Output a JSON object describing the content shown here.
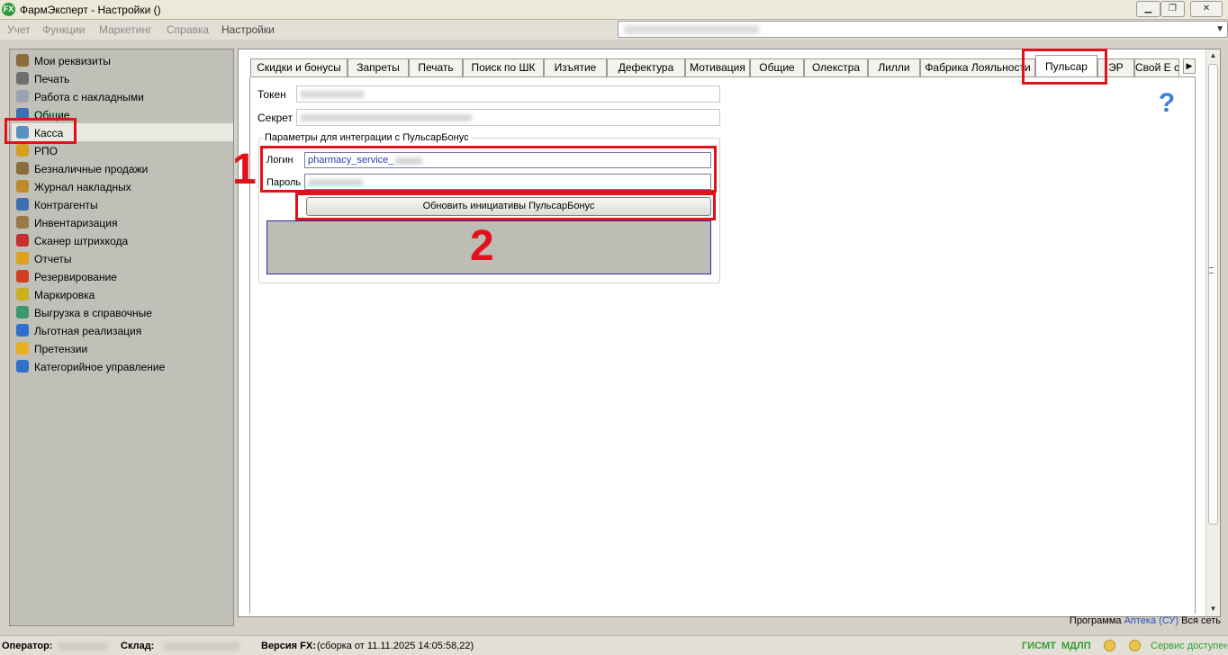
{
  "window": {
    "title": "ФармЭксперт - Настройки ()",
    "app_icon": "FX",
    "minimize": "▁",
    "maximize": "❐",
    "close": "✕"
  },
  "menu": {
    "items": [
      "Учет",
      "Функции",
      "Маркетинг",
      "Справка",
      "Настройки"
    ]
  },
  "sidebar": {
    "items": [
      {
        "label": "Мои реквизиты",
        "icon": "person-icon",
        "color": "#8a6d3b"
      },
      {
        "label": "Печать",
        "icon": "printer-icon",
        "color": "#6f6f6f"
      },
      {
        "label": "Работа с накладными",
        "icon": "document-icon",
        "color": "#9aa4b0"
      },
      {
        "label": "Общие",
        "icon": "folder-icon",
        "color": "#3f6fb0"
      },
      {
        "label": "Касса",
        "icon": "cash-register-icon",
        "color": "#5d8fc4"
      },
      {
        "label": "РПО",
        "icon": "medal-icon",
        "color": "#d6a020"
      },
      {
        "label": "Безналичные продажи",
        "icon": "card-icon",
        "color": "#8a6d3b"
      },
      {
        "label": "Журнал накладных",
        "icon": "journal-icon",
        "color": "#c08a2a"
      },
      {
        "label": "Контрагенты",
        "icon": "contacts-icon",
        "color": "#3f6fb0"
      },
      {
        "label": "Инвентаризация",
        "icon": "inventory-icon",
        "color": "#9a7a4a"
      },
      {
        "label": "Сканер штрихкода",
        "icon": "barcode-icon",
        "color": "#c43030"
      },
      {
        "label": "Отчеты",
        "icon": "chart-icon",
        "color": "#e0a020"
      },
      {
        "label": "Резервирование",
        "icon": "reserve-icon",
        "color": "#d04020"
      },
      {
        "label": "Маркировка",
        "icon": "check-icon",
        "color": "#c8b020"
      },
      {
        "label": "Выгрузка в справочные",
        "icon": "upload-icon",
        "color": "#3a9a6a"
      },
      {
        "label": "Льготная реализация",
        "icon": "book-icon",
        "color": "#2f6fd0"
      },
      {
        "label": "Претензии",
        "icon": "smile-icon",
        "color": "#e6b020"
      },
      {
        "label": "Категорийное управление",
        "icon": "category-icon",
        "color": "#3070c8"
      }
    ]
  },
  "tabs": [
    "Скидки и бонусы",
    "Запреты",
    "Печать",
    "Поиск по ШК",
    "Изъятие",
    "Дефектура",
    "Мотивация",
    "Общие",
    "Олекстра",
    "Лилли",
    "Фабрика Лояльности",
    "Пульсар",
    "ЭР",
    "Свой Е com"
  ],
  "tab_scroll_icon": "▶",
  "form": {
    "token_label": "Токен",
    "secret_label": "Секрет",
    "group_title": "Параметры для интеграции с ПульсарБонус",
    "login_label": "Логин",
    "login_value": "pharmacy_service_",
    "password_label": "Пароль",
    "update_button": "Обновить инициативы ПульсарБонус"
  },
  "help_icon": "?",
  "annotations": {
    "one": "1",
    "two": "2"
  },
  "scrollbar": {
    "up": "▲",
    "down": "▼"
  },
  "footer": {
    "program_prefix": "Программа",
    "program_link": "Аптека (СУ)",
    "program_suffix": "Вся сеть"
  },
  "status": {
    "operator_label": "Оператор:",
    "warehouse_label": "Склад:",
    "version_label": "Версия FX:",
    "version_value": "(сборка от 11.11.2025 14:05:58,22)",
    "gismt": "ГИСМТ",
    "mdlp": "МДЛП",
    "service": "Сервис доступен"
  },
  "colors": {
    "annotation_red": "#e0131a",
    "link_blue": "#2c4fb8",
    "status_green": "#2e9e2e"
  }
}
